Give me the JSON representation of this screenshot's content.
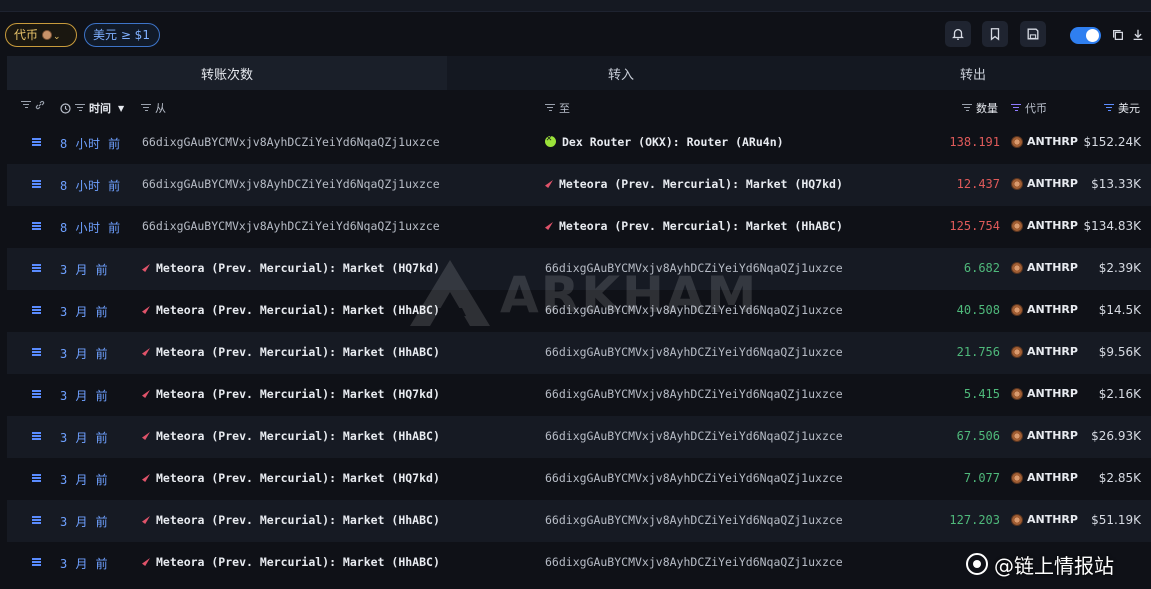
{
  "filters": {
    "token_chip": "代币",
    "usd_chip": "美元 ≥ $1"
  },
  "tabs": [
    {
      "label": "转账次数"
    },
    {
      "label": "转入"
    },
    {
      "label": "转出"
    }
  ],
  "columns": {
    "time": "时间",
    "from": "从",
    "to": "至",
    "amount": "数量",
    "token": "代币",
    "usd": "美元"
  },
  "rows": [
    {
      "time": "8 小时 前",
      "from": "66dixgGAuBYCMVxjv8AyhDCZiYeiYd6NqaQZj1uxzce",
      "to": "Dex Router (OKX): Router (ARu4n)",
      "amount": "138.191",
      "direction": "out",
      "token": "ANTHRP",
      "usd": "$152.24K"
    },
    {
      "time": "8 小时 前",
      "from": "66dixgGAuBYCMVxjv8AyhDCZiYeiYd6NqaQZj1uxzce",
      "to": "Meteora (Prev. Mercurial): Market (HQ7kd)",
      "amount": "12.437",
      "direction": "out",
      "token": "ANTHRP",
      "usd": "$13.33K"
    },
    {
      "time": "8 小时 前",
      "from": "66dixgGAuBYCMVxjv8AyhDCZiYeiYd6NqaQZj1uxzce",
      "to": "Meteora (Prev. Mercurial): Market (HhABC)",
      "amount": "125.754",
      "direction": "out",
      "token": "ANTHRP",
      "usd": "$134.83K"
    },
    {
      "time": "3 月 前",
      "from": "Meteora (Prev. Mercurial): Market (HQ7kd)",
      "to": "66dixgGAuBYCMVxjv8AyhDCZiYeiYd6NqaQZj1uxzce",
      "amount": "6.682",
      "direction": "in",
      "token": "ANTHRP",
      "usd": "$2.39K"
    },
    {
      "time": "3 月 前",
      "from": "Meteora (Prev. Mercurial): Market (HhABC)",
      "to": "66dixgGAuBYCMVxjv8AyhDCZiYeiYd6NqaQZj1uxzce",
      "amount": "40.508",
      "direction": "in",
      "token": "ANTHRP",
      "usd": "$14.5K"
    },
    {
      "time": "3 月 前",
      "from": "Meteora (Prev. Mercurial): Market (HhABC)",
      "to": "66dixgGAuBYCMVxjv8AyhDCZiYeiYd6NqaQZj1uxzce",
      "amount": "21.756",
      "direction": "in",
      "token": "ANTHRP",
      "usd": "$9.56K"
    },
    {
      "time": "3 月 前",
      "from": "Meteora (Prev. Mercurial): Market (HQ7kd)",
      "to": "66dixgGAuBYCMVxjv8AyhDCZiYeiYd6NqaQZj1uxzce",
      "amount": "5.415",
      "direction": "in",
      "token": "ANTHRP",
      "usd": "$2.16K"
    },
    {
      "time": "3 月 前",
      "from": "Meteora (Prev. Mercurial): Market (HhABC)",
      "to": "66dixgGAuBYCMVxjv8AyhDCZiYeiYd6NqaQZj1uxzce",
      "amount": "67.506",
      "direction": "in",
      "token": "ANTHRP",
      "usd": "$26.93K"
    },
    {
      "time": "3 月 前",
      "from": "Meteora (Prev. Mercurial): Market (HQ7kd)",
      "to": "66dixgGAuBYCMVxjv8AyhDCZiYeiYd6NqaQZj1uxzce",
      "amount": "7.077",
      "direction": "in",
      "token": "ANTHRP",
      "usd": "$2.85K"
    },
    {
      "time": "3 月 前",
      "from": "Meteora (Prev. Mercurial): Market (HhABC)",
      "to": "66dixgGAuBYCMVxjv8AyhDCZiYeiYd6NqaQZj1uxzce",
      "amount": "127.203",
      "direction": "in",
      "token": "ANTHRP",
      "usd": "$51.19K"
    },
    {
      "time": "3 月 前",
      "from": "Meteora (Prev. Mercurial): Market (HhABC)",
      "to": "66dixgGAuBYCMVxjv8AyhDCZiYeiYd6NqaQZj1uxzce",
      "amount": "",
      "direction": "in",
      "token": "",
      "usd": ""
    }
  ],
  "watermark": "ARKHAM",
  "brand_watermark": "@链上情报站",
  "colors": {
    "accent": "#2f7ff0",
    "outflow": "#e05a5a",
    "inflow": "#4fb97b",
    "time_link": "#6ea0ff"
  }
}
